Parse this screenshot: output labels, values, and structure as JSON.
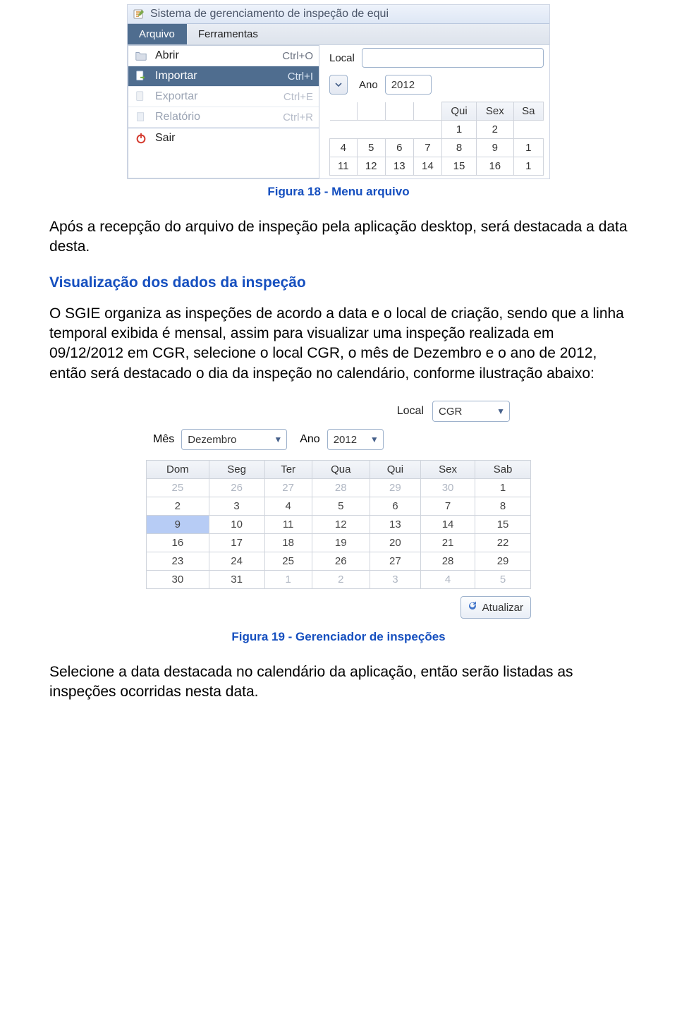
{
  "shot1": {
    "title": "Sistema de gerenciamento de inspeção de equi",
    "menubar": [
      "Arquivo",
      "Ferramentas"
    ],
    "menu_items": [
      {
        "label": "Abrir",
        "shortcut": "Ctrl+O",
        "state": "normal"
      },
      {
        "label": "Importar",
        "shortcut": "Ctrl+I",
        "state": "highlight"
      },
      {
        "label": "Exportar",
        "shortcut": "Ctrl+E",
        "state": "disabled"
      },
      {
        "label": "Relatório",
        "shortcut": "Ctrl+R",
        "state": "disabled"
      },
      {
        "label": "Sair",
        "shortcut": "",
        "state": "sair"
      }
    ],
    "local_label": "Local",
    "ano_label": "Ano",
    "ano_value": "2012",
    "cal_headers": [
      "Qui",
      "Sex",
      "Sa"
    ],
    "cal_rows": [
      [
        "",
        "",
        "",
        "",
        "1",
        "2",
        ""
      ],
      [
        "4",
        "5",
        "6",
        "7",
        "8",
        "9",
        "1"
      ],
      [
        "11",
        "12",
        "13",
        "14",
        "15",
        "16",
        "1"
      ]
    ]
  },
  "fig18": "Figura 18 - Menu arquivo",
  "para1": "Após a recepção do arquivo de inspeção pela aplicação desktop, será destacada a data desta.",
  "heading": "Visualização dos dados da inspeção",
  "para2": "O SGIE organiza as inspeções de acordo a data e o local de criação, sendo que a linha temporal exibida é mensal, assim para visualizar uma inspeção realizada em 09/12/2012 em CGR, selecione o local CGR, o mês de Dezembro e o ano de 2012, então será destacado o dia da inspeção no calendário, conforme ilustração abaixo:",
  "shot2": {
    "local_label": "Local",
    "local_value": "CGR",
    "mes_label": "Mês",
    "mes_value": "Dezembro",
    "ano_label": "Ano",
    "ano_value": "2012",
    "btn": "Atualizar",
    "headers": [
      "Dom",
      "Seg",
      "Ter",
      "Qua",
      "Qui",
      "Sex",
      "Sab"
    ],
    "rows": [
      [
        {
          "v": "25",
          "dim": true
        },
        {
          "v": "26",
          "dim": true
        },
        {
          "v": "27",
          "dim": true
        },
        {
          "v": "28",
          "dim": true
        },
        {
          "v": "29",
          "dim": true
        },
        {
          "v": "30",
          "dim": true
        },
        {
          "v": "1"
        }
      ],
      [
        {
          "v": "2"
        },
        {
          "v": "3"
        },
        {
          "v": "4"
        },
        {
          "v": "5"
        },
        {
          "v": "6"
        },
        {
          "v": "7"
        },
        {
          "v": "8"
        }
      ],
      [
        {
          "v": "9",
          "sel": true
        },
        {
          "v": "10"
        },
        {
          "v": "11"
        },
        {
          "v": "12"
        },
        {
          "v": "13"
        },
        {
          "v": "14"
        },
        {
          "v": "15"
        }
      ],
      [
        {
          "v": "16"
        },
        {
          "v": "17"
        },
        {
          "v": "18"
        },
        {
          "v": "19"
        },
        {
          "v": "20"
        },
        {
          "v": "21"
        },
        {
          "v": "22"
        }
      ],
      [
        {
          "v": "23"
        },
        {
          "v": "24"
        },
        {
          "v": "25"
        },
        {
          "v": "26"
        },
        {
          "v": "27"
        },
        {
          "v": "28"
        },
        {
          "v": "29"
        }
      ],
      [
        {
          "v": "30"
        },
        {
          "v": "31"
        },
        {
          "v": "1",
          "dim": true
        },
        {
          "v": "2",
          "dim": true
        },
        {
          "v": "3",
          "dim": true
        },
        {
          "v": "4",
          "dim": true
        },
        {
          "v": "5",
          "dim": true
        }
      ]
    ]
  },
  "fig19": "Figura 19 - Gerenciador de inspeções",
  "para3": "Selecione a data destacada no calendário da aplicação, então serão listadas as inspeções ocorridas nesta data."
}
